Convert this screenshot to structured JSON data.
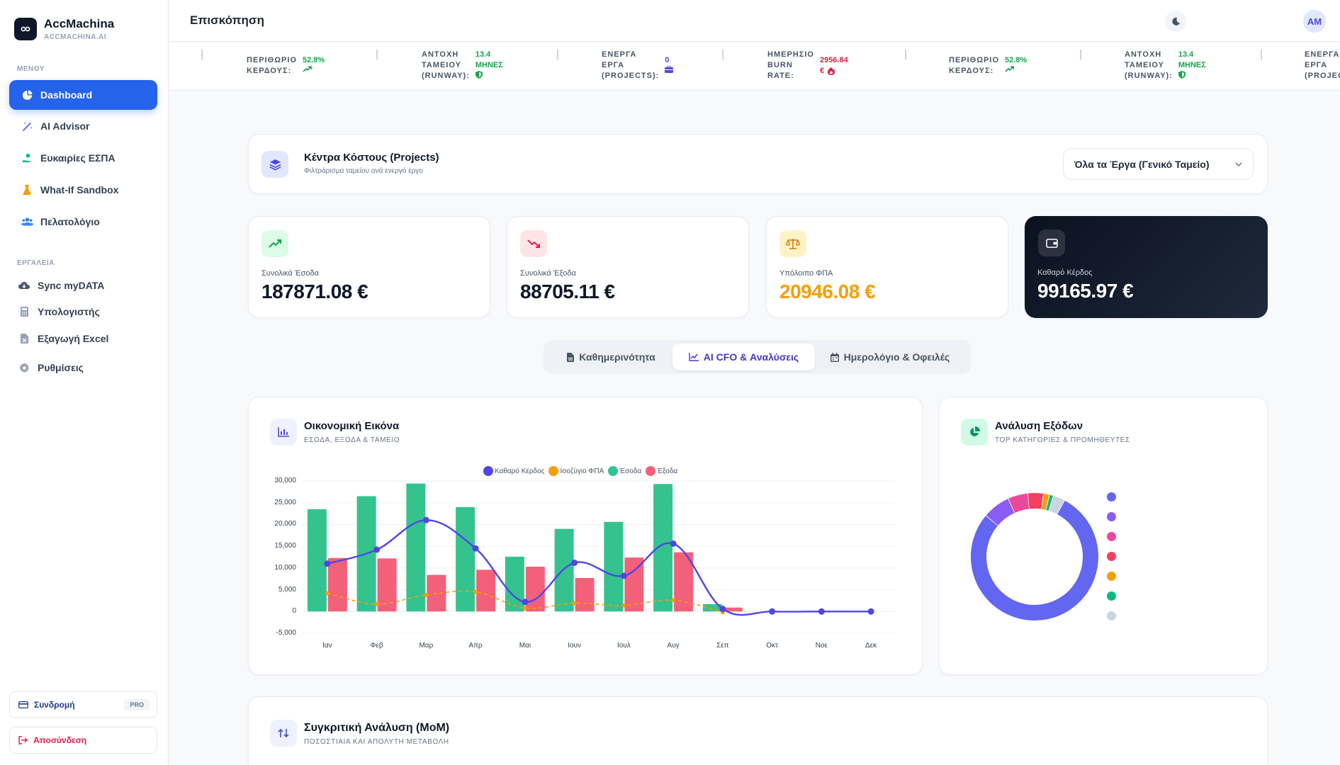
{
  "app": {
    "name": "AccMachina",
    "subdomain": "ACCMACHINA.AI"
  },
  "sidebar": {
    "menu_label": "ΜΕΝΟΥ",
    "tools_label": "ΕΡΓΑΛΕΙΑ",
    "menu": [
      {
        "label": "Dashboard",
        "icon": "pie-chart-icon",
        "active": true
      },
      {
        "label": "AI Advisor",
        "icon": "magic-wand-icon"
      },
      {
        "label": "Ευκαιρίες ΕΣΠΑ",
        "icon": "hand-coins-icon"
      },
      {
        "label": "What-If Sandbox",
        "icon": "flask-icon"
      },
      {
        "label": "Πελατολόγιο",
        "icon": "users-icon"
      }
    ],
    "tools": [
      {
        "label": "Sync myDATA",
        "icon": "cloud-icon"
      },
      {
        "label": "Υπολογιστής",
        "icon": "calculator-icon"
      },
      {
        "label": "Εξαγωγή Excel",
        "icon": "file-excel-icon"
      },
      {
        "label": "Ρυθμίσεις",
        "icon": "gear-icon"
      }
    ],
    "subscription": {
      "label": "Συνδρομή",
      "badge": "PRO"
    },
    "logout": {
      "label": "Αποσύνδεση"
    }
  },
  "header": {
    "title": "Επισκόπηση",
    "avatar": "AM"
  },
  "ticker": [
    {
      "label": [
        "ΠΕΡΙΘΩΡΙΟ",
        "ΚΕΡΔΟΥΣ:"
      ],
      "value": [
        "52.8%"
      ],
      "color": "#16a34a",
      "icon": "trend-up-icon"
    },
    {
      "label": [
        "ΑΝΤΟΧΗ",
        "ΤΑΜΕΙΟΥ",
        "(RUNWAY):"
      ],
      "value": [
        "13.4",
        "ΜΗΝΕΣ"
      ],
      "color": "#16a34a",
      "icon": "shield-icon"
    },
    {
      "label": [
        "ΕΝΕΡΓΑ",
        "ΕΡΓΑ",
        "(PROJECTS):"
      ],
      "value": [
        "0"
      ],
      "color": "#4f46e5",
      "icon": "briefcase-icon"
    },
    {
      "label": [
        "ΗΜΕΡΗΣΙΟ",
        "BURN",
        "RATE:"
      ],
      "value": [
        "2956.84",
        "€"
      ],
      "color": "#e11d48",
      "icon": "fire-icon"
    },
    {
      "label": [
        "ΠΕΡΙΘΩΡΙΟ",
        "ΚΕΡΔΟΥΣ:"
      ],
      "value": [
        "52.8%"
      ],
      "color": "#16a34a",
      "icon": "trend-up-icon"
    },
    {
      "label": [
        "ΑΝΤΟΧΗ",
        "ΤΑΜΕΙΟΥ",
        "(RUNWAY):"
      ],
      "value": [
        "13.4",
        "ΜΗΝΕΣ"
      ],
      "color": "#16a34a",
      "icon": "shield-icon"
    },
    {
      "label": [
        "ΕΝΕΡΓΑ",
        "ΕΡΓΑ",
        "(PROJEC"
      ],
      "value": [],
      "color": "#4f46e5",
      "icon": ""
    }
  ],
  "cost_centers": {
    "title": "Κέντρα Κόστους (Projects)",
    "subtitle": "Φιλτράρισμα ταμείου ανά ενεργό έργο",
    "select_value": "Όλα τα Έργα (Γενικό Ταμείο)"
  },
  "kpis": [
    {
      "label": "Συνολικά Έσοδα",
      "value": "187871.08 €",
      "color": "#0f172a",
      "icon": "trend-up-icon"
    },
    {
      "label": "Συνολικά Έξοδα",
      "value": "88705.11 €",
      "color": "#0f172a",
      "icon": "trend-down-icon"
    },
    {
      "label": "Υπόλοιπο ΦΠΑ",
      "value": "20946.08 €",
      "color": "#f59e0b",
      "icon": "scale-icon"
    },
    {
      "label": "Καθαρό Κέρδος",
      "value": "99165.97 €",
      "color": "#ffffff",
      "icon": "wallet-icon"
    }
  ],
  "tabs": [
    {
      "label": "Καθημερινότητα",
      "icon": "document-icon"
    },
    {
      "label": "AI CFO & Αναλύσεις",
      "icon": "line-chart-icon",
      "active": true
    },
    {
      "label": "Ημερολόγιο & Οφειλές",
      "icon": "calendar-icon"
    }
  ],
  "financial_card": {
    "title": "Οικονομική Εικόνα",
    "subtitle": "ΕΣΟΔΑ, ΕΞΟΔΑ & ΤΑΜΕΙΟ"
  },
  "expenses_card": {
    "title": "Ανάλυση Εξόδων",
    "subtitle": "TOP ΚΑΤΗΓΟΡΙΕΣ & ΠΡΟΜΗΘΕΥΤΕΣ"
  },
  "mom_card": {
    "title": "Συγκριτική Ανάλυση (MoM)",
    "subtitle": "ΠΟΣΟΣΤΙΑΙΑ ΚΑΙ ΑΠΟΛΥΤΗ ΜΕΤΑΒΟΛΗ"
  },
  "chart_data": [
    {
      "type": "bar",
      "categories": [
        "Ιαν",
        "Φεβ",
        "Μαρ",
        "Απρ",
        "Μαι",
        "Ιουν",
        "Ιουλ",
        "Αυγ",
        "Σεπ",
        "Οκτ",
        "Νοε",
        "Δεκ"
      ],
      "ylim": [
        -5000,
        30000
      ],
      "yticks": [
        "30,000",
        "25,000",
        "20,000",
        "15,000",
        "10,000",
        "5,000",
        "0",
        "-5,000"
      ],
      "ytick_values": [
        30000,
        25000,
        20000,
        15000,
        10000,
        5000,
        0,
        -5000
      ],
      "grid": true,
      "legend": "top",
      "series": [
        {
          "name": "Καθαρό Κέρδος",
          "kind": "line",
          "color": "#4f46e5",
          "values": [
            11000,
            14200,
            21000,
            14500,
            2200,
            11200,
            8200,
            15600,
            600,
            0,
            0,
            0
          ]
        },
        {
          "name": "Ισοζύγιο ΦΠΑ",
          "kind": "dashed-line",
          "color": "#f59e0b",
          "values": [
            4200,
            1700,
            3800,
            4500,
            800,
            1900,
            1400,
            2600,
            -200,
            0,
            0,
            0
          ]
        },
        {
          "name": "Έσοδα",
          "kind": "bar",
          "color": "#34c38f",
          "values": [
            23500,
            26500,
            29400,
            24000,
            12600,
            19000,
            20600,
            29300,
            1700,
            0,
            0,
            0
          ]
        },
        {
          "name": "Έξοδα",
          "kind": "bar",
          "color": "#f3607a",
          "values": [
            12300,
            12200,
            8400,
            9600,
            10300,
            7700,
            12400,
            13600,
            900,
            0,
            0,
            0
          ]
        }
      ]
    },
    {
      "type": "pie",
      "donut": true,
      "legend": "right",
      "series": [
        {
          "color": "#6366f1",
          "value": 78
        },
        {
          "color": "#8b5cf6",
          "value": 7
        },
        {
          "color": "#ec4899",
          "value": 5
        },
        {
          "color": "#f43f5e",
          "value": 4
        },
        {
          "color": "#f59e0b",
          "value": 1.5
        },
        {
          "color": "#10b981",
          "value": 1
        },
        {
          "color": "#cbd5e1",
          "value": 3
        }
      ]
    }
  ]
}
